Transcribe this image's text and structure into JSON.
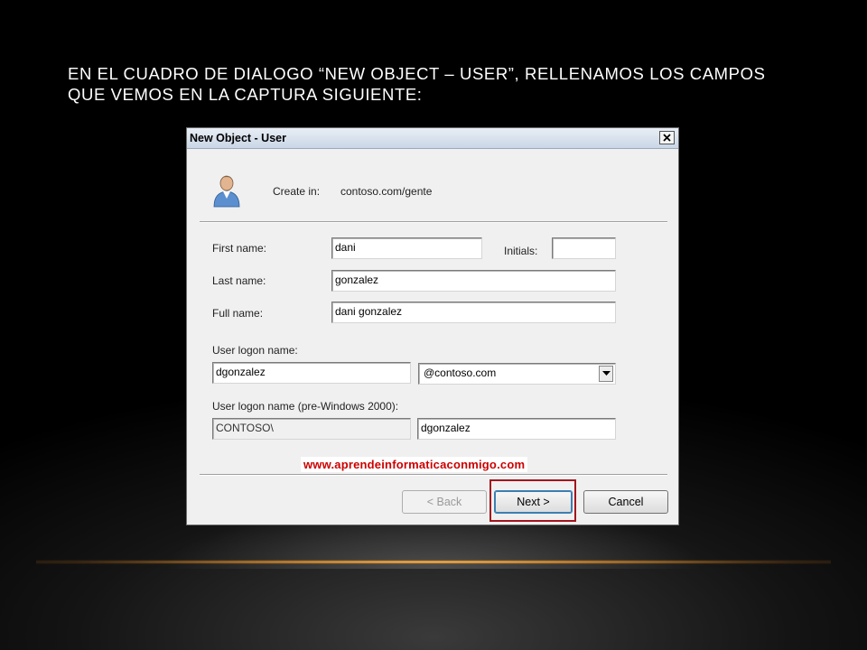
{
  "slide": {
    "title": "EN EL CUADRO DE DIALOGO “NEW OBJECT – USER”, RELLENAMOS LOS CAMPOS QUE VEMOS EN LA CAPTURA SIGUIENTE:"
  },
  "dialog": {
    "title": "New Object - User",
    "create_in_label": "Create in:",
    "create_in_value": "contoso.com/gente",
    "first_name": {
      "label": "First name:",
      "value": "dani"
    },
    "initials": {
      "label": "Initials:",
      "value": ""
    },
    "last_name": {
      "label": "Last name:",
      "value": "gonzalez"
    },
    "full_name": {
      "label": "Full name:",
      "value": "dani gonzalez"
    },
    "logon_name": {
      "label": "User logon name:",
      "value": "dgonzalez",
      "domain": "@contoso.com"
    },
    "logon_name_pre2000": {
      "label": "User logon name (pre-Windows 2000):",
      "domain_prefix": "CONTOSO\\",
      "value": "dgonzalez"
    },
    "watermark": "www.aprendeinformaticaconmigo.com",
    "buttons": {
      "back": "< Back",
      "next": "Next >",
      "cancel": "Cancel"
    }
  },
  "colors": {
    "highlight_border": "#a3161c",
    "watermark_text": "#cc0000"
  },
  "icons": {
    "close": "close-icon",
    "user": "user-icon",
    "dropdown": "chevron-down-icon"
  }
}
